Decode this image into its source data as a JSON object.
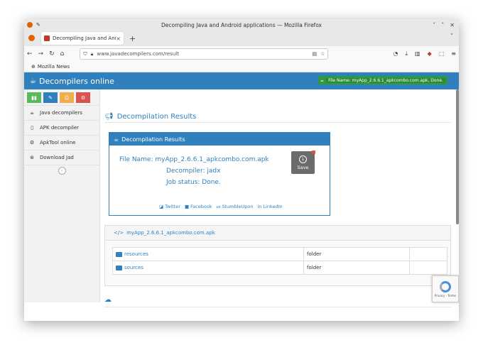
{
  "window": {
    "title": "Decompiling Java and Android applications — Mozilla Firefox",
    "controls": [
      "˅",
      "˄",
      "✕"
    ]
  },
  "tabs": [
    {
      "label": "Decompiling Java and Andr",
      "close": "×"
    }
  ],
  "newtab": "+",
  "tablist": "˅",
  "navbar": {
    "url": "www.javadecompilers.com/result",
    "back": "←",
    "forward": "→",
    "reload": "↻",
    "home": "⌂"
  },
  "bookmarks": [
    {
      "label": "Mozilla News"
    }
  ],
  "app": {
    "brand": "Decompilers online",
    "notification": "File Name: myApp_2.6.6.1_apkcombo.com.apk, Done."
  },
  "sidebar": {
    "items": [
      {
        "label": "Java decompilers"
      },
      {
        "label": "APK decompiler"
      },
      {
        "label": "ApkTool online"
      },
      {
        "label": "Download Jad"
      }
    ]
  },
  "main": {
    "page_title": "Decompilation Results",
    "result": {
      "header": "Decompilation Results",
      "file_name": "File Name: myApp_2.6.6.1_apkcombo.com.apk",
      "decompiler": "Decompiler: jadx",
      "status": "Job status: Done.",
      "save_label": "Save"
    },
    "share": [
      "Twitter",
      "Facebook",
      "StumbleUpon",
      "LinkedIn"
    ],
    "files": {
      "header": "myApp_2.6.6.1_apkcombo.com.apk",
      "rows": [
        {
          "name": "resources",
          "type": "folder"
        },
        {
          "name": "sources",
          "type": "folder"
        }
      ]
    }
  },
  "recaptcha": "Privacy - Terms",
  "colors": {
    "accent": "#2f80bd",
    "notify": "#2f9a3c",
    "save": "#6b6b6b"
  }
}
